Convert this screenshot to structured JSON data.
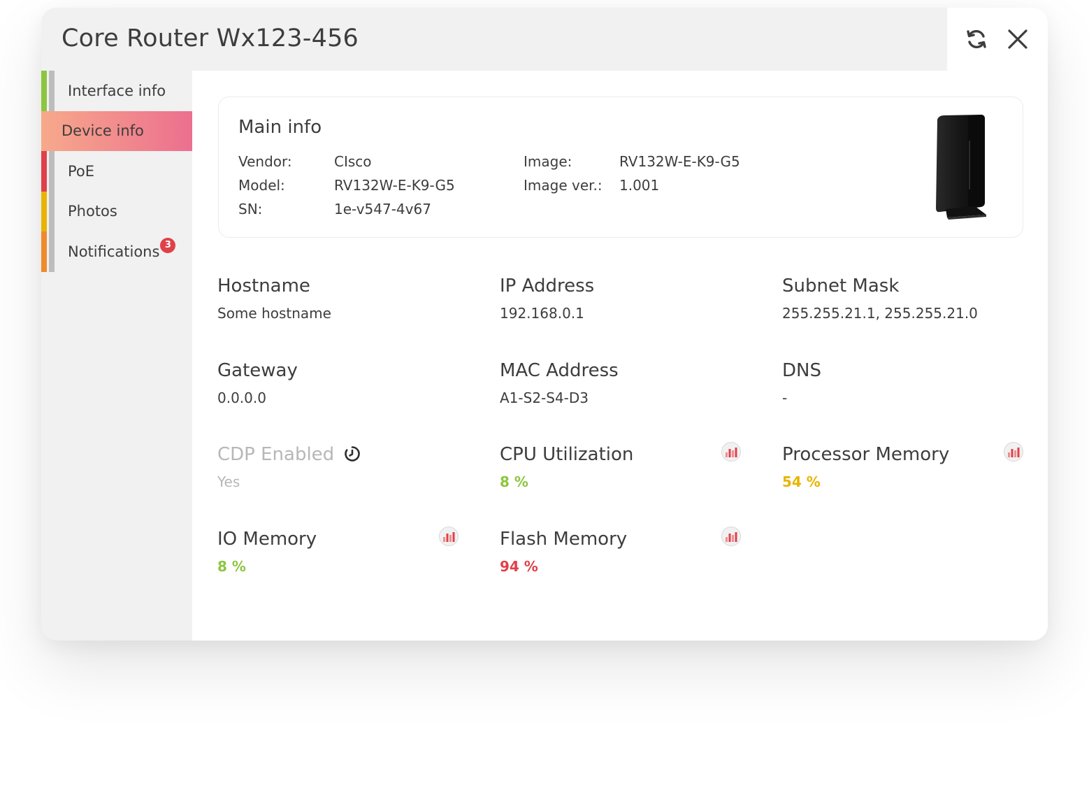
{
  "window": {
    "title": "Core Router Wx123-456",
    "actions": {
      "refresh_icon": "refresh-icon",
      "close_icon": "close-icon"
    }
  },
  "sidebar": {
    "items": [
      {
        "label": "Interface info",
        "color": "#8cc63f",
        "active": false
      },
      {
        "label": "Device info",
        "color": "#f7a98b",
        "active": true
      },
      {
        "label": "PoE",
        "color": "#e0404a",
        "active": false
      },
      {
        "label": "Photos",
        "color": "#e8b400",
        "active": false
      },
      {
        "label": "Notifications",
        "color": "#f08a2c",
        "active": false,
        "badge": "3"
      }
    ]
  },
  "main_info": {
    "title": "Main info",
    "vendor_label": "Vendor:",
    "vendor": "CIsco",
    "model_label": "Model:",
    "model": "RV132W-E-K9-G5",
    "sn_label": "SN:",
    "sn": "1e-v547-4v67",
    "image_label": "Image:",
    "image": "RV132W-E-K9-G5",
    "image_ver_label": "Image ver.:",
    "image_ver": "1.001"
  },
  "fields": {
    "hostname": {
      "label": "Hostname",
      "value": "Some hostname"
    },
    "ip_address": {
      "label": "IP Address",
      "value": "192.168.0.1"
    },
    "subnet_mask": {
      "label": "Subnet Mask",
      "value": "255.255.21.1, 255.255.21.0"
    },
    "gateway": {
      "label": "Gateway",
      "value": "0.0.0.0"
    },
    "mac_address": {
      "label": "MAC Address",
      "value": "A1-S2-S4-D3"
    },
    "dns": {
      "label": "DNS",
      "value": "-"
    },
    "cdp_enabled": {
      "label": "CDP Enabled",
      "value": "Yes"
    },
    "cpu_utilization": {
      "label": "CPU Utilization",
      "value": "8 %",
      "color": "#8cc63f"
    },
    "processor_memory": {
      "label": "Processor Memory",
      "value": "54 %",
      "color": "#e8b400"
    },
    "io_memory": {
      "label": "IO Memory",
      "value": "8 %",
      "color": "#8cc63f"
    },
    "flash_memory": {
      "label": "Flash Memory",
      "value": "94 %",
      "color": "#e0404a"
    }
  },
  "colors": {
    "accent_gradient_start": "#f7a98b",
    "accent_gradient_end": "#ec6f8f",
    "ok": "#8cc63f",
    "warn": "#e8b400",
    "critical": "#e0404a"
  }
}
